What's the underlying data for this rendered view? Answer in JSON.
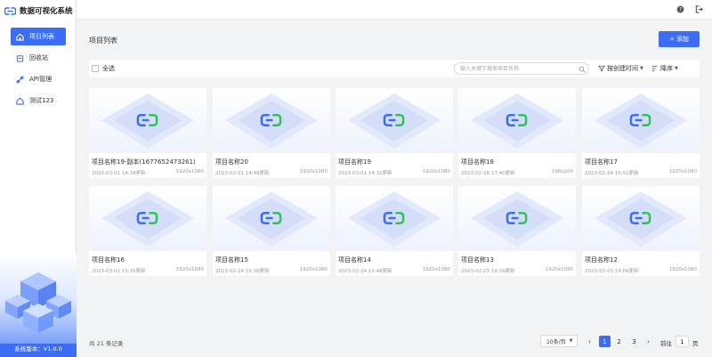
{
  "app": {
    "title": "数据可视化系统",
    "version": "系统版本：V1.0.0"
  },
  "sidebar": {
    "items": [
      {
        "label": "项目列表",
        "icon": "home-icon",
        "active": true
      },
      {
        "label": "回收站",
        "icon": "recycle-bin-icon",
        "active": false
      },
      {
        "label": "API管理",
        "icon": "api-link-icon",
        "active": false
      },
      {
        "label": "测试123",
        "icon": "folder-icon",
        "active": false
      }
    ]
  },
  "header": {
    "help_icon": "help-icon",
    "logout_icon": "logout-icon"
  },
  "main": {
    "title": "项目列表",
    "add_label": "添加",
    "select_all": "全选",
    "search_placeholder": "输入关键字搜索项目名称",
    "sort_by": "按创建时间",
    "sort_order": "降序"
  },
  "projects": [
    {
      "name": "项目名称19-副本(1677652473261)",
      "updated": "2023-03-01 14:34更新",
      "size": "1920x1080"
    },
    {
      "name": "项目名称20",
      "updated": "2023-03-01 14:48更新",
      "size": "1920x1080"
    },
    {
      "name": "项目名称19",
      "updated": "2023-03-01 14:32更新",
      "size": "1920x1080"
    },
    {
      "name": "项目名称18",
      "updated": "2023-02-28 17:40更新",
      "size": "198x200"
    },
    {
      "name": "项目名称17",
      "updated": "2023-02-24 15:51更新",
      "size": "1920x1080"
    },
    {
      "name": "项目名称16",
      "updated": "2023-03-01 15:35更新",
      "size": "1920x1080"
    },
    {
      "name": "项目名称15",
      "updated": "2023-02-24 16:36更新",
      "size": "1920x1080"
    },
    {
      "name": "项目名称14",
      "updated": "2023-02-24 10:46更新",
      "size": "1920x1080"
    },
    {
      "name": "项目名称13",
      "updated": "2023-02-23 19:39更新",
      "size": "1920x1080"
    },
    {
      "name": "项目名称12",
      "updated": "2023-02-23 14:06更新",
      "size": "1920x1080"
    }
  ],
  "pagination": {
    "total": "共 21 条记录",
    "page_size": "10条/页",
    "prev": "‹",
    "pages": [
      "1",
      "2",
      "3"
    ],
    "next": "›",
    "goto_label": "前往",
    "goto_value": "1",
    "goto_unit": "页"
  },
  "colors": {
    "accent": "#3b6ef5",
    "logo_green": "#2fc25b",
    "background": "#f2f3f5"
  }
}
